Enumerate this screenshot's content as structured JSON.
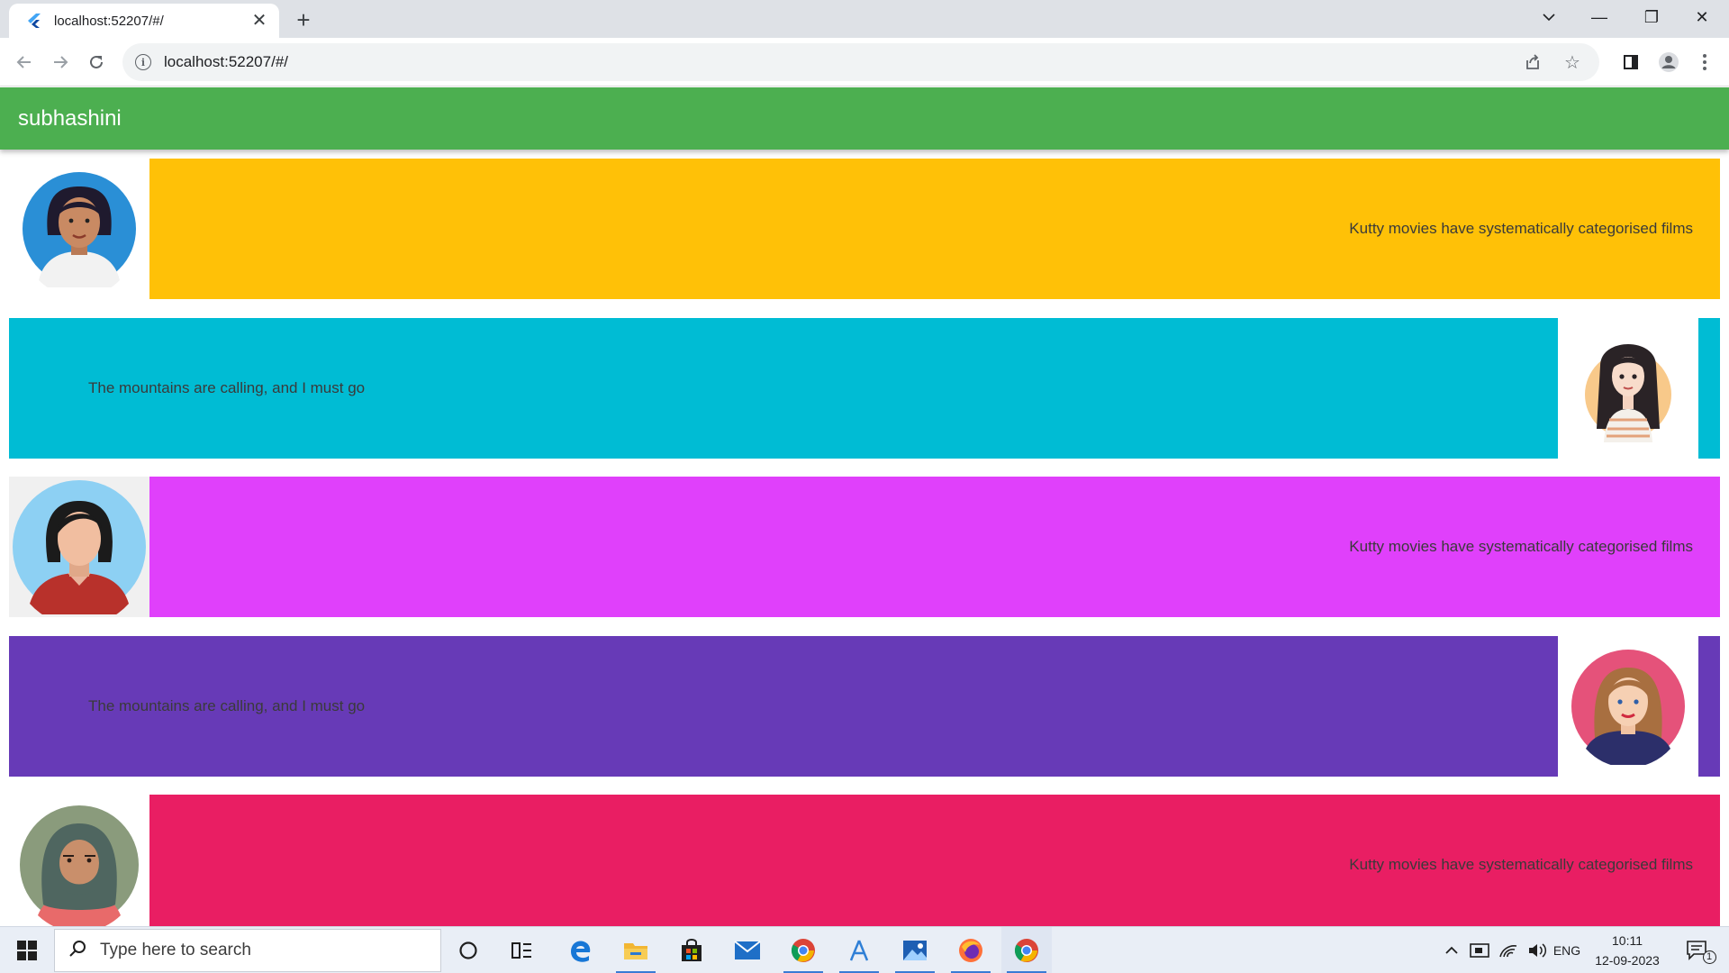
{
  "browser": {
    "tab_title": "localhost:52207/#/",
    "tab_close": "✕",
    "new_tab": "+",
    "url": "localhost:52207/#/",
    "window_controls": {
      "minimize": "—",
      "maximize": "❐",
      "close": "✕"
    }
  },
  "app": {
    "title": "subhashini",
    "cards": [
      {
        "text": "Kutty movies have systematically categorised films",
        "avatar_side": "left",
        "color": "#ffc107"
      },
      {
        "text": "The mountains are calling, and I must go",
        "avatar_side": "right",
        "color": "#00bcd4"
      },
      {
        "text": "Kutty movies have systematically categorised films",
        "avatar_side": "left",
        "color": "#e040fb"
      },
      {
        "text": "The mountains are calling, and I must go",
        "avatar_side": "right",
        "color": "#673ab7"
      },
      {
        "text": "Kutty movies have systematically categorised films",
        "avatar_side": "left",
        "color": "#e91e63"
      }
    ]
  },
  "taskbar": {
    "search_placeholder": "Type here to search",
    "language": "ENG",
    "time": "10:11",
    "date": "12-09-2023",
    "notification_count": "1"
  }
}
